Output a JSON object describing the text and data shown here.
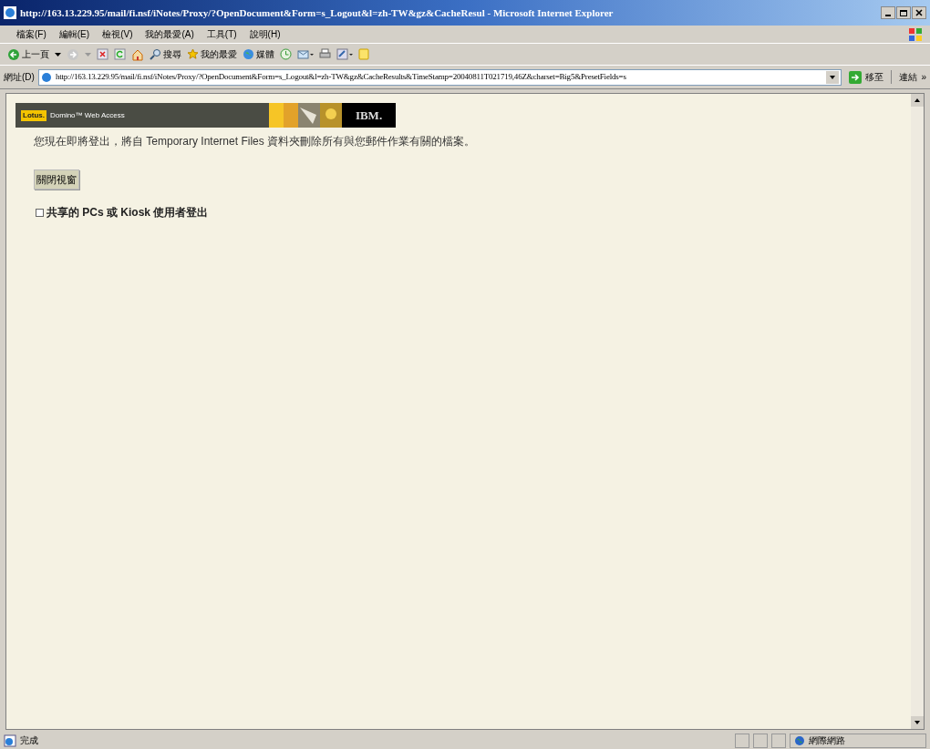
{
  "window": {
    "title": "http://163.13.229.95/mail/fi.nsf/iNotes/Proxy/?OpenDocument&Form=s_Logout&l=zh-TW&gz&CacheResul - Microsoft Internet Explorer"
  },
  "menu": [
    "檔案(F)",
    "編輯(E)",
    "檢視(V)",
    "我的最愛(A)",
    "工具(T)",
    "說明(H)"
  ],
  "toolbar": [
    {
      "kind": "back",
      "label": "上一頁"
    },
    {
      "kind": "forward"
    },
    {
      "kind": "stop"
    },
    {
      "kind": "refresh"
    },
    {
      "kind": "home"
    },
    {
      "kind": "search",
      "label": "搜尋"
    },
    {
      "kind": "favorites",
      "label": "我的最愛"
    },
    {
      "kind": "media",
      "label": "媒體"
    },
    {
      "kind": "history"
    },
    {
      "kind": "mail"
    },
    {
      "kind": "print"
    },
    {
      "kind": "edit"
    },
    {
      "kind": "messenger"
    }
  ],
  "address": {
    "label": "網址(D)",
    "value": "http://163.13.229.95/mail/fi.nsf/iNotes/Proxy/?OpenDocument&Form=s_Logout&l=zh-TW&gz&CacheResults&TimeStamp=20040811T021719,46Z&charset=Big5&PresetFields=s",
    "go": "移至",
    "links": "連結",
    "more": "»"
  },
  "banner": {
    "badge": "Lotus.",
    "product": "Domino™ Web Access",
    "logo": "IBM."
  },
  "message": "您現在即將登出，將自 Temporary Internet Files 資料夾刪除所有與您郵件作業有關的檔案。",
  "close_button": "關閉視窗",
  "shared_checkbox": {
    "label": "共享的 PCs 或 Kiosk 使用者登出",
    "checked": false
  },
  "status_bar": {
    "text": "完成",
    "zone": "網際網路"
  }
}
